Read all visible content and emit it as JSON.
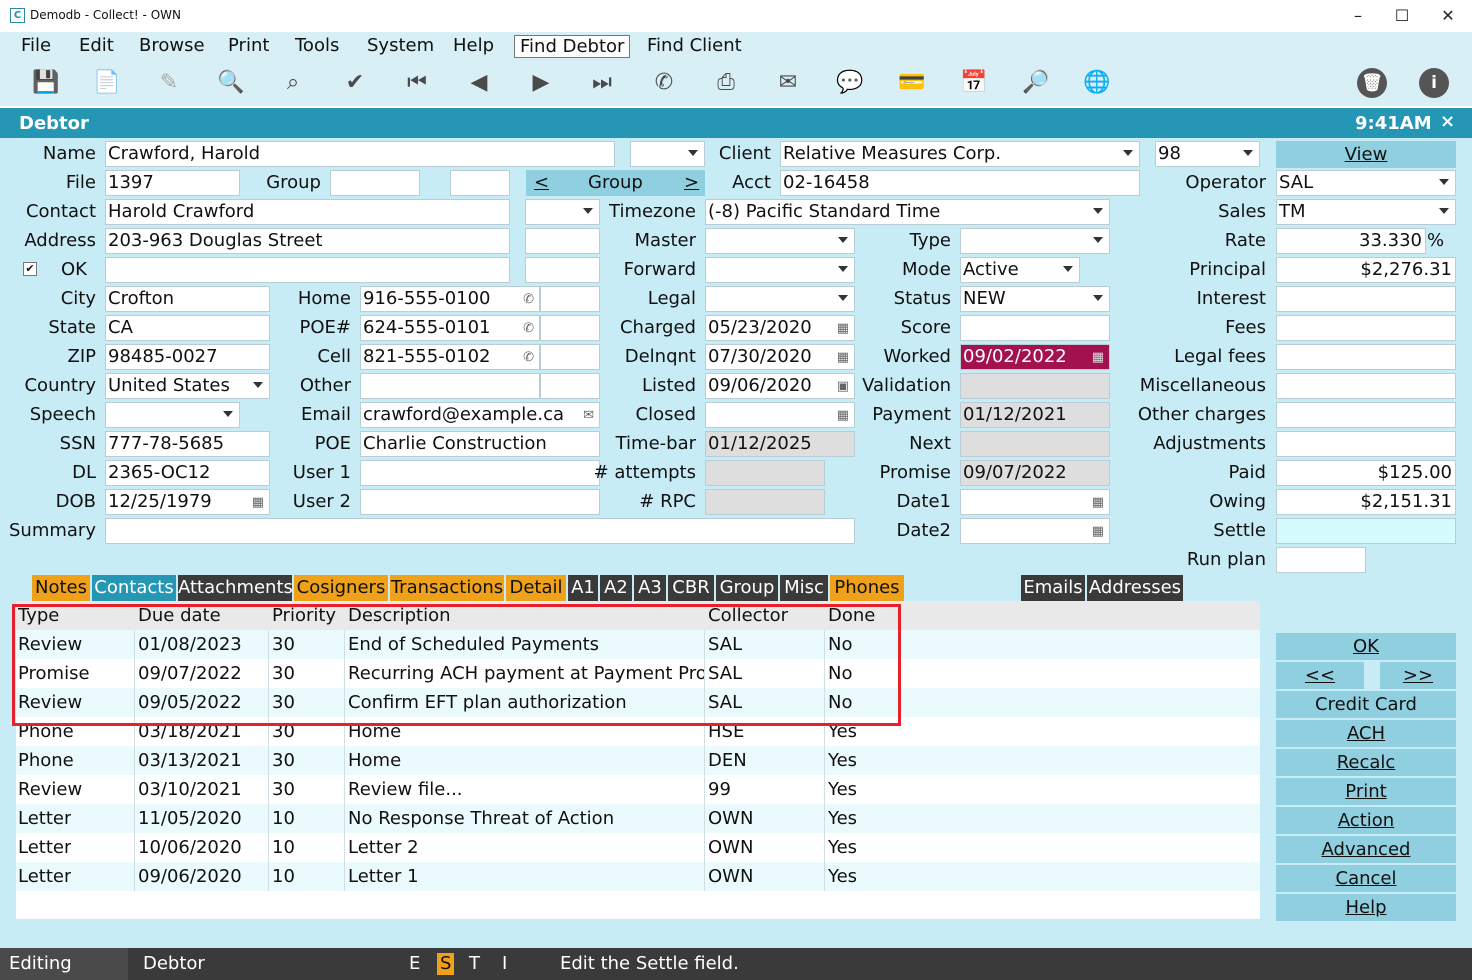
{
  "window": {
    "title": "Demodb - Collect! - OWN",
    "app_icon": "C",
    "minimize": "–",
    "maximize": "☐",
    "close": "✕"
  },
  "menu": [
    "File",
    "Edit",
    "Browse",
    "Print",
    "Tools",
    "System",
    "Help",
    "Find Debtor",
    "Find Client"
  ],
  "toolbar": [
    {
      "name": "save-icon",
      "glyph": "💾"
    },
    {
      "name": "new-record-icon",
      "glyph": "📄"
    },
    {
      "name": "edit-record-icon",
      "glyph": "✎"
    },
    {
      "name": "find-record-icon",
      "glyph": "🔍"
    },
    {
      "name": "binoculars-icon",
      "glyph": "⌕"
    },
    {
      "name": "checkmark-icon",
      "glyph": "✔"
    },
    {
      "name": "first-record-icon",
      "glyph": "⏮"
    },
    {
      "name": "previous-record-icon",
      "glyph": "◀"
    },
    {
      "name": "next-record-icon",
      "glyph": "▶"
    },
    {
      "name": "last-record-icon",
      "glyph": "⏭"
    },
    {
      "name": "phone-icon",
      "glyph": "✆"
    },
    {
      "name": "printer-icon",
      "glyph": "⎙"
    },
    {
      "name": "envelope-icon",
      "glyph": "✉"
    },
    {
      "name": "chat-bubble-icon",
      "glyph": "💬"
    },
    {
      "name": "payment-card-icon",
      "glyph": "💳"
    },
    {
      "name": "calendar-add-icon",
      "glyph": "📅"
    },
    {
      "name": "search-icon",
      "glyph": "🔎"
    },
    {
      "name": "globe-icon",
      "glyph": "🌐"
    },
    {
      "name": "delete-icon",
      "glyph": "🗑"
    },
    {
      "name": "info-icon",
      "glyph": "i"
    }
  ],
  "header": {
    "title": "Debtor",
    "time": "9:41AM",
    "close": "×"
  },
  "labels": {
    "name": "Name",
    "file": "File",
    "group": "Group",
    "contact": "Contact",
    "address": "Address",
    "ok": "OK",
    "city": "City",
    "state": "State",
    "zip": "ZIP",
    "country": "Country",
    "speech": "Speech",
    "ssn": "SSN",
    "dl": "DL",
    "dob": "DOB",
    "summary": "Summary",
    "home": "Home",
    "poe_num": "POE#",
    "cell": "Cell",
    "other": "Other",
    "email": "Email",
    "poe": "POE",
    "user1": "User 1",
    "user2": "User 2",
    "client": "Client",
    "acct": "Acct",
    "timezone": "Timezone",
    "master": "Master",
    "forward": "Forward",
    "legal": "Legal",
    "charged": "Charged",
    "delnqnt": "Delnqnt",
    "listed": "Listed",
    "closed": "Closed",
    "timebar": "Time-bar",
    "attempts": "# attempts",
    "rpc": "# RPC",
    "type": "Type",
    "mode": "Mode",
    "status": "Status",
    "score": "Score",
    "worked": "Worked",
    "validation": "Validation",
    "payment": "Payment",
    "next": "Next",
    "promise": "Promise",
    "date1": "Date1",
    "date2": "Date2",
    "operator": "Operator",
    "sales": "Sales",
    "rate": "Rate",
    "principal": "Principal",
    "interest": "Interest",
    "fees": "Fees",
    "legal_fees": "Legal fees",
    "miscellaneous": "Miscellaneous",
    "other_charges": "Other charges",
    "adjustments": "Adjustments",
    "paid": "Paid",
    "owing": "Owing",
    "settle": "Settle",
    "run_plan": "Run plan"
  },
  "values": {
    "name": "Crawford, Harold",
    "file": "1397",
    "contact": "Harold Crawford",
    "address": "203-963 Douglas Street",
    "ok_checked": "✔",
    "city": "Crofton",
    "state": "CA",
    "zip": "98485-0027",
    "country": "United States",
    "ssn": "777-78-5685",
    "dl": "2365-OC12",
    "dob": "12/25/1979",
    "home": "916-555-0100",
    "poe_num": "624-555-0101",
    "cell": "821-555-0102",
    "email": "crawford@example.ca",
    "poe": "Charlie Construction",
    "client": "Relative Measures Corp.",
    "client_num": "98",
    "acct": "02-16458",
    "timezone": "(-8) Pacific Standard Time",
    "charged": "05/23/2020",
    "delnqnt": "07/30/2020",
    "listed": "09/06/2020",
    "timebar": "01/12/2025",
    "mode": "Active",
    "status": "NEW",
    "worked": "09/02/2022",
    "payment": "01/12/2021",
    "promise": "09/07/2022",
    "operator": "SAL",
    "sales": "TM",
    "rate": "33.330",
    "rate_unit": "%",
    "principal": "$2,276.31",
    "paid": "$125.00",
    "owing": "$2,151.31"
  },
  "group_nav": {
    "prev": "<",
    "label": "Group",
    "next": ">"
  },
  "view_button": "View",
  "tabs_left": [
    {
      "label": "Notes",
      "style": "or"
    },
    {
      "label": "Contacts",
      "style": "act"
    },
    {
      "label": "Attachments",
      "style": "dk"
    },
    {
      "label": "Cosigners",
      "style": "or"
    },
    {
      "label": "Transactions",
      "style": "or"
    },
    {
      "label": "Detail",
      "style": "or"
    },
    {
      "label": "A1",
      "style": "dk"
    },
    {
      "label": "A2",
      "style": "dk"
    },
    {
      "label": "A3",
      "style": "dk"
    },
    {
      "label": "CBR",
      "style": "dk"
    },
    {
      "label": "Group",
      "style": "dk"
    },
    {
      "label": "Misc",
      "style": "dk"
    },
    {
      "label": "Phones",
      "style": "or"
    }
  ],
  "tabs_right": [
    {
      "label": "Emails"
    },
    {
      "label": "Addresses"
    }
  ],
  "contacts_table": {
    "columns": [
      "Type",
      "Due date",
      "Priority",
      "Description",
      "Collector",
      "Done"
    ],
    "rows": [
      [
        "Review",
        "01/08/2023",
        "30",
        "End of Scheduled Payments",
        "SAL",
        "No"
      ],
      [
        "Promise",
        "09/07/2022",
        "30",
        "Recurring ACH payment at Payment Provid",
        "SAL",
        "No"
      ],
      [
        "Review",
        "09/05/2022",
        "30",
        "Confirm EFT plan authorization",
        "SAL",
        "No"
      ],
      [
        "Phone",
        "03/18/2021",
        "30",
        "Home",
        "HSE",
        "Yes"
      ],
      [
        "Phone",
        "03/13/2021",
        "30",
        "Home",
        "DEN",
        "Yes"
      ],
      [
        "Review",
        "03/10/2021",
        "30",
        "Review file...",
        "99",
        "Yes"
      ],
      [
        "Letter",
        "11/05/2020",
        "10",
        "No Response Threat of Action",
        "OWN",
        "Yes"
      ],
      [
        "Letter",
        "10/06/2020",
        "10",
        "Letter 2",
        "OWN",
        "Yes"
      ],
      [
        "Letter",
        "09/06/2020",
        "10",
        "Letter 1",
        "OWN",
        "Yes"
      ]
    ]
  },
  "buttons": {
    "ok": "OK",
    "prev": "<<",
    "next": ">>",
    "credit_card": "Credit Card",
    "ach": "ACH",
    "recalc": "Recalc",
    "print": "Print",
    "action": "Action",
    "advanced": "Advanced",
    "cancel": "Cancel",
    "help": "Help"
  },
  "statusbar": {
    "mode": "Editing",
    "form": "Debtor",
    "flags": [
      "E",
      "S",
      "T",
      "I"
    ],
    "active_flag": "S",
    "message": "Edit the Settle field."
  }
}
